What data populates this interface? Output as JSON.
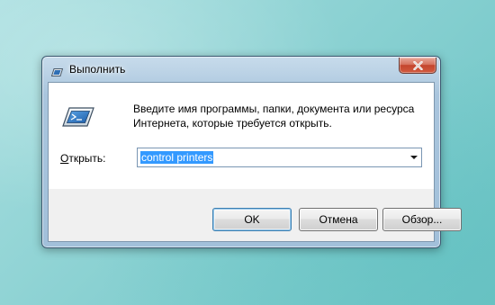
{
  "window": {
    "title": "Выполнить"
  },
  "dialog": {
    "description_line1": "Введите имя программы, папки, документа или ресурса",
    "description_line2": "Интернета, которые требуется открыть.",
    "open_label_mnemonic": "О",
    "open_label_rest": "ткрыть:",
    "open_value": "control printers"
  },
  "buttons": {
    "ok": "OK",
    "cancel": "Отмена",
    "browse": "Обзор..."
  },
  "icons": {
    "title": "run-icon",
    "main": "run-icon",
    "close": "close-icon",
    "dropdown": "chevron-down-icon"
  },
  "colors": {
    "selection": "#3399ff",
    "close_button": "#c4452e"
  }
}
